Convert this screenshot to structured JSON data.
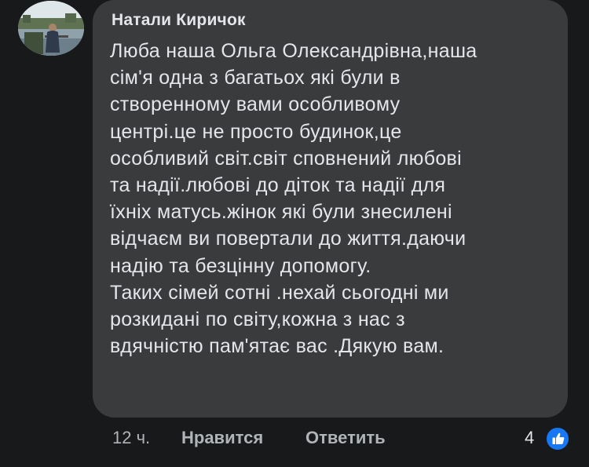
{
  "comment": {
    "author": "Натали Киричок",
    "avatar_icon": "profile-photo-avatar",
    "text_lines": [
      "Люба наша Ольга Олександрівна,наша",
      "сім'я одна з багатьох які були в",
      "створенному вами особливому",
      "центрі.це не просто будинок,це",
      "особливий світ.світ сповнений любові",
      "та надії.любові до діток та надії для",
      "їхніх матусь.жінок які були знесилені",
      "відчаєм ви повертали до життя.даючи",
      "надію та безцінну допомогу.",
      "Таких сімей сотні .нехай сьогодні ми",
      "розкидані по світу,кожна з нас з",
      "вдячністю пам'ятає вас .Дякую вам."
    ]
  },
  "actions": {
    "timestamp": "12 ч.",
    "like_label": "Нравится",
    "reply_label": "Ответить",
    "reaction_count": "4",
    "reaction_icon": "thumbs-up-icon"
  },
  "colors": {
    "background": "#18191a",
    "bubble": "#3a3b3c",
    "text": "#e4e6eb",
    "muted_text": "#b0b3b8",
    "like_blue": "#1877f2"
  }
}
